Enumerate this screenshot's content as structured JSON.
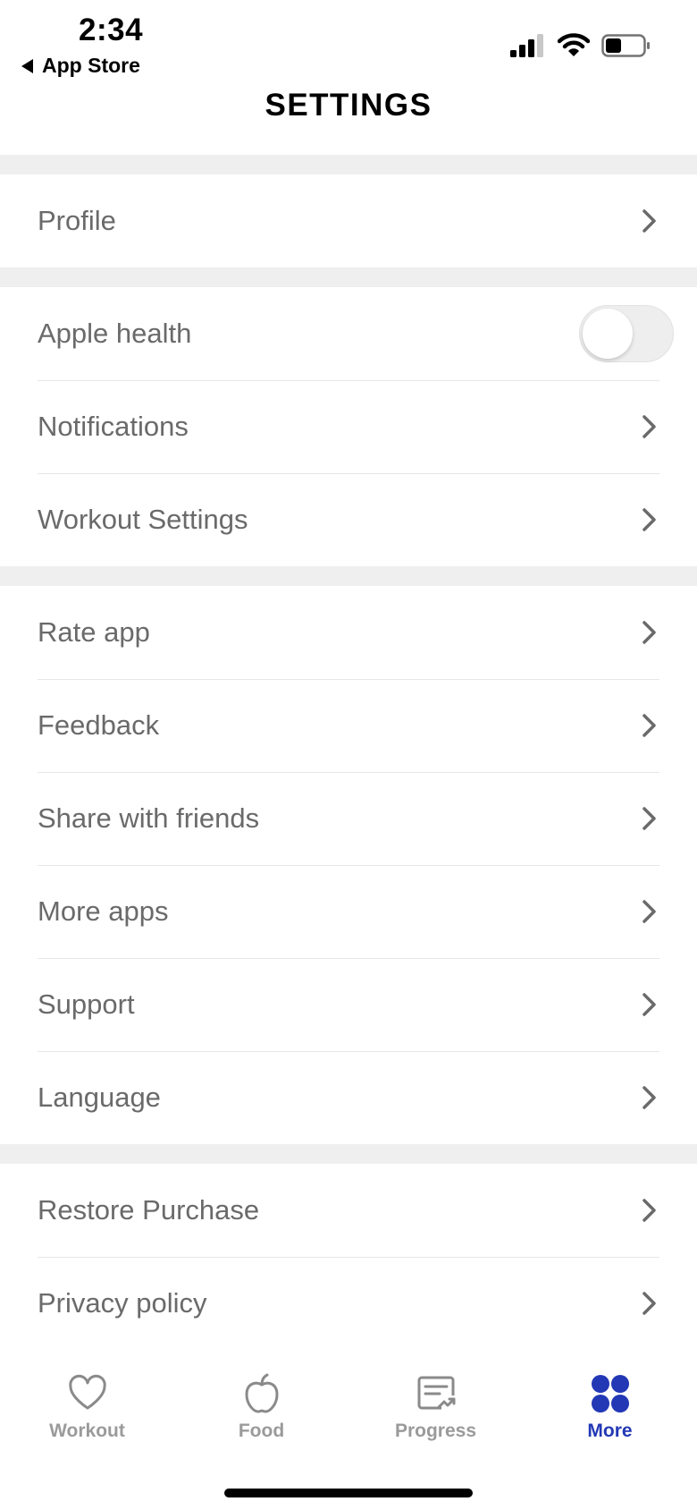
{
  "status_bar": {
    "time": "2:34",
    "back_label": "App Store"
  },
  "header": {
    "title": "SETTINGS"
  },
  "groups": [
    {
      "items": [
        {
          "label": "Profile",
          "type": "link"
        }
      ]
    },
    {
      "items": [
        {
          "label": "Apple health",
          "type": "toggle",
          "on": false
        },
        {
          "label": "Notifications",
          "type": "link"
        },
        {
          "label": "Workout Settings",
          "type": "link"
        }
      ]
    },
    {
      "items": [
        {
          "label": "Rate app",
          "type": "link"
        },
        {
          "label": "Feedback",
          "type": "link"
        },
        {
          "label": "Share with friends",
          "type": "link"
        },
        {
          "label": "More apps",
          "type": "link"
        },
        {
          "label": "Support",
          "type": "link"
        },
        {
          "label": "Language",
          "type": "link"
        }
      ]
    },
    {
      "items": [
        {
          "label": "Restore Purchase",
          "type": "link"
        },
        {
          "label": "Privacy policy",
          "type": "link"
        }
      ]
    }
  ],
  "tab_bar": {
    "tabs": [
      {
        "label": "Workout",
        "icon": "heart-icon",
        "active": false
      },
      {
        "label": "Food",
        "icon": "apple-icon",
        "active": false
      },
      {
        "label": "Progress",
        "icon": "progress-chart-icon",
        "active": false
      },
      {
        "label": "More",
        "icon": "grid-dots-icon",
        "active": true
      }
    ]
  },
  "colors": {
    "accent": "#2238b5",
    "inactive_tab": "#9a9a9a",
    "row_text": "#6a6a6a",
    "section_gap": "#efefef"
  }
}
